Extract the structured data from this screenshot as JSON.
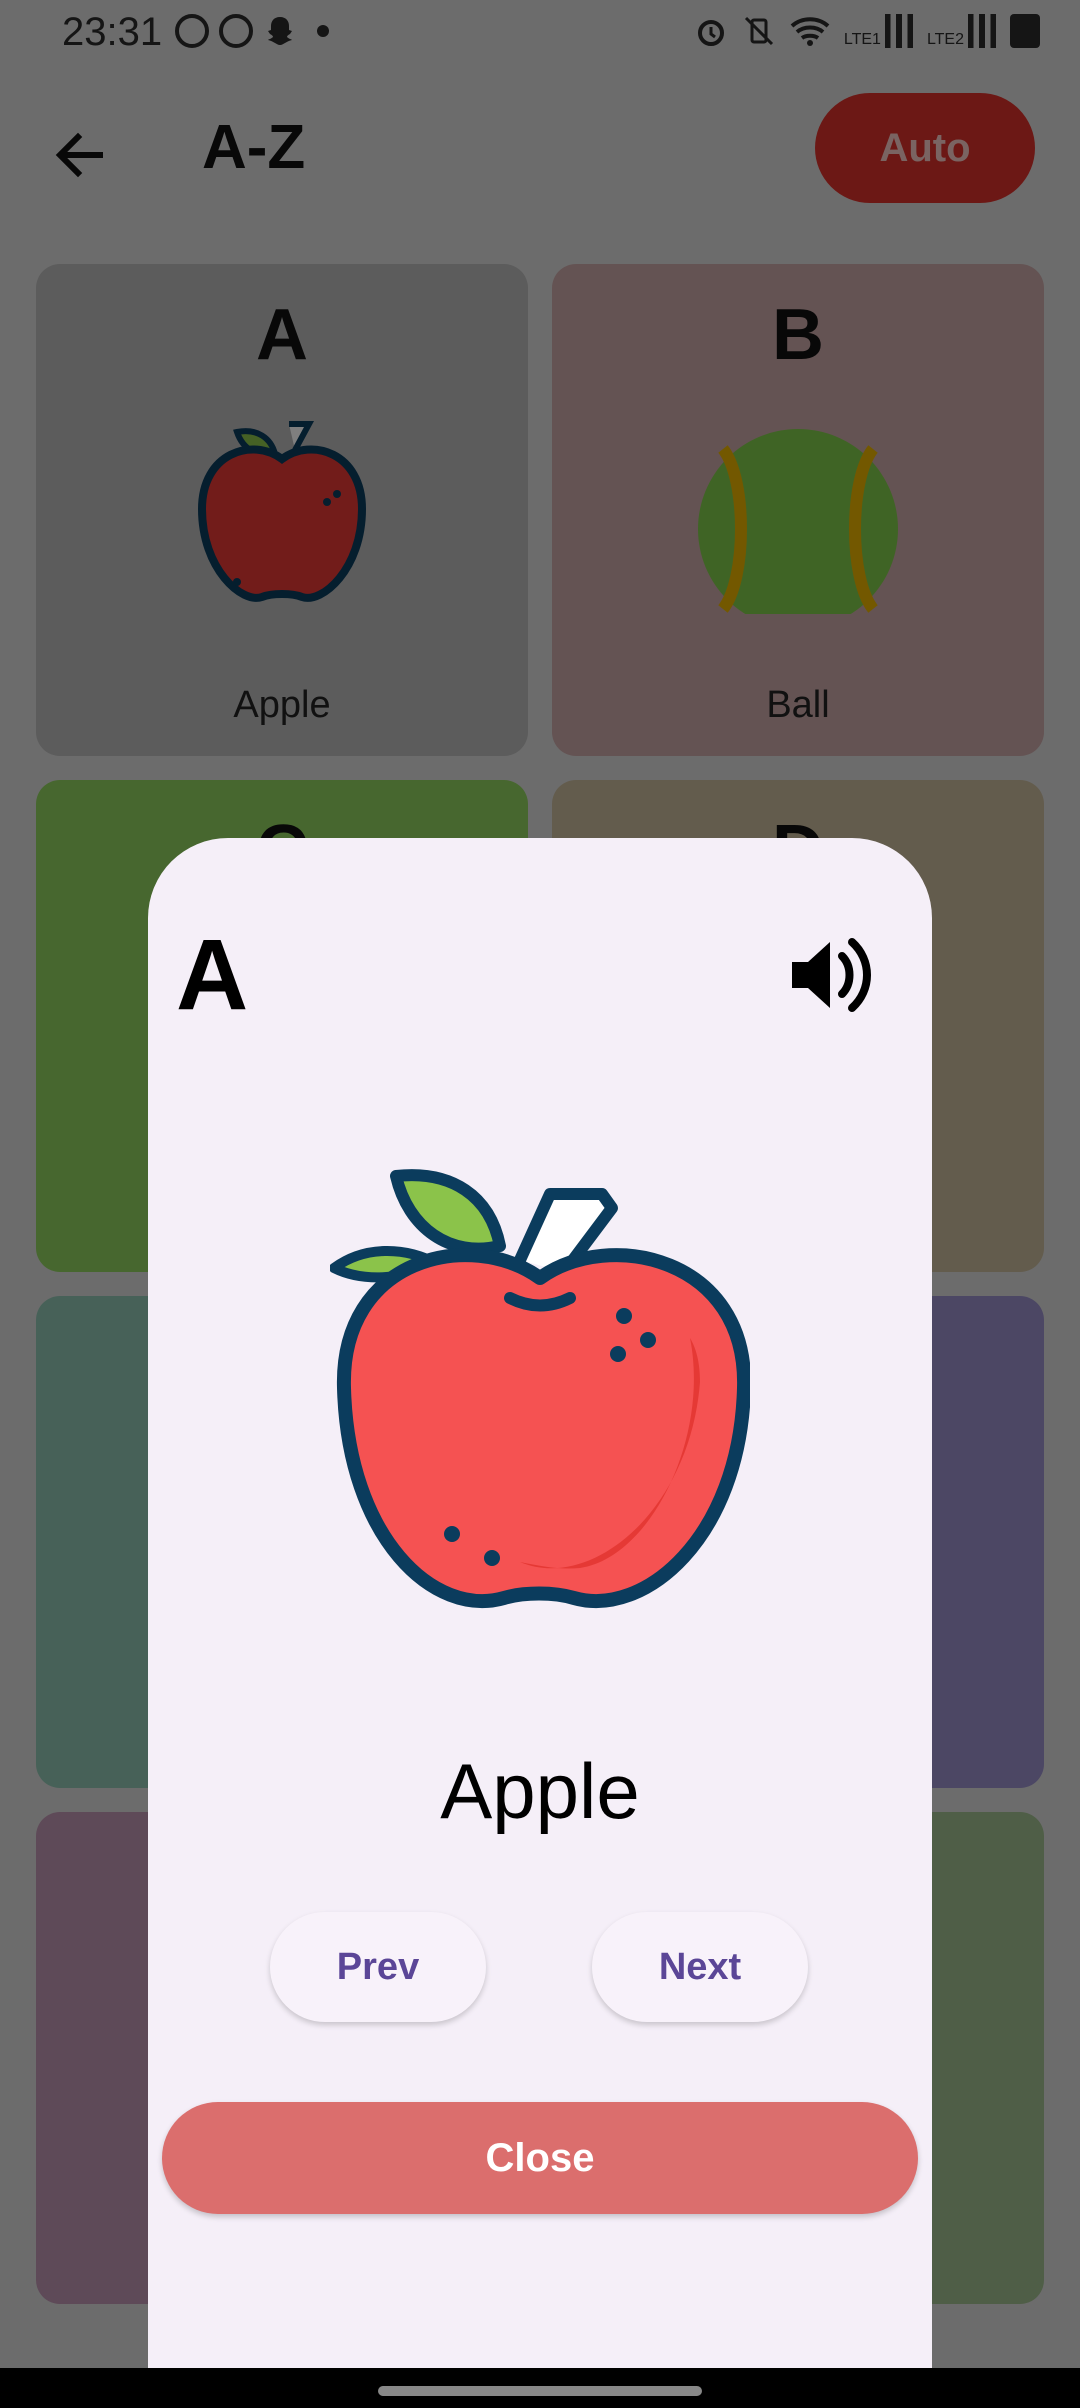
{
  "status_bar": {
    "time": "23:31",
    "left_icons": [
      "whatsapp-icon",
      "whatsapp-business-icon",
      "snapchat-icon",
      "notification-dot-icon"
    ],
    "right_icons": [
      "alarm-icon",
      "vibrate-icon",
      "wifi-icon",
      "signal-lte1-icon",
      "signal-lte2-icon",
      "battery-icon"
    ],
    "lte1": "LTE1",
    "lte2": "LTE2"
  },
  "app_bar": {
    "title": "A-Z",
    "auto_label": "Auto",
    "back_icon": "arrow-left-icon",
    "auto_color": "#d9302a"
  },
  "grid": {
    "cards": [
      {
        "letter": "A",
        "word": "Apple",
        "color": "#b8b8b8",
        "icon": "apple-icon"
      },
      {
        "letter": "B",
        "word": "Ball",
        "color": "#c9a6a6",
        "icon": "tennis-ball-icon"
      },
      {
        "letter": "C",
        "word": "",
        "color": "#8fcf5f"
      },
      {
        "letter": "D",
        "word": "",
        "color": "#c6b89a"
      },
      {
        "letter": "",
        "word": "",
        "color": "#8fc2b0"
      },
      {
        "letter": "",
        "word": "",
        "color": "#998fc9"
      },
      {
        "letter": "",
        "word": "",
        "color": "#bd94b0"
      },
      {
        "letter": "",
        "word": "",
        "color": "#9fbd8f"
      }
    ]
  },
  "dialog": {
    "letter": "A",
    "word": "Apple",
    "prev_label": "Prev",
    "next_label": "Next",
    "close_label": "Close",
    "speaker_icon": "volume-icon",
    "image_icon": "apple-icon",
    "background": "#f5eff8",
    "accent": "#5b4697",
    "close_color": "#db6e6d"
  }
}
